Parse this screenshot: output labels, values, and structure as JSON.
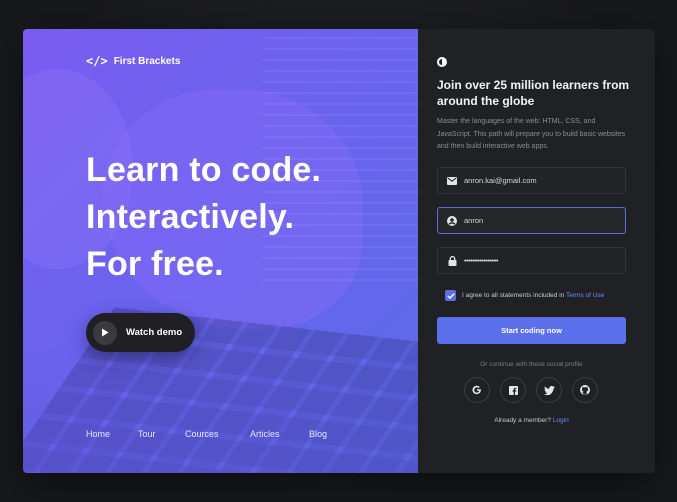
{
  "brand": {
    "name": "First Brackets",
    "icon": "code-brackets-icon"
  },
  "hero": {
    "line1": "Learn to code.",
    "line2": "Interactively.",
    "line3": "For free."
  },
  "watch_demo": {
    "label": "Watch demo",
    "icon": "play-icon"
  },
  "nav": {
    "items": [
      "Home",
      "Tour",
      "Cources",
      "Articles",
      "Blog"
    ]
  },
  "signup": {
    "title": "Join over 25 million learners from around the globe",
    "description": "Master the languages of the web: HTML, CSS, and JavaScript. This path will prepare you to build basic websites and then build interactive web apps.",
    "email": {
      "value": "anron.kai@gmail.com",
      "icon": "mail-icon"
    },
    "username": {
      "value": "anron",
      "icon": "user-icon"
    },
    "password": {
      "value": "••••••••••••••••",
      "icon": "lock-icon"
    },
    "agree_text": "I agree to all statements included in",
    "agree_link": "Terms of Use",
    "agree_checked": true,
    "cta": "Start coding now",
    "or_text": "Or continue with these social profile",
    "socials": [
      "google-icon",
      "facebook-icon",
      "twitter-icon",
      "github-icon"
    ],
    "member_text": "Already a member?",
    "login_link": "Login"
  },
  "colors": {
    "accent": "#5d70ec",
    "panel_dark": "#202124",
    "hero_gradient_start": "#7a5cf0",
    "hero_gradient_end": "#5a6ce8",
    "link": "#6f8cff"
  }
}
